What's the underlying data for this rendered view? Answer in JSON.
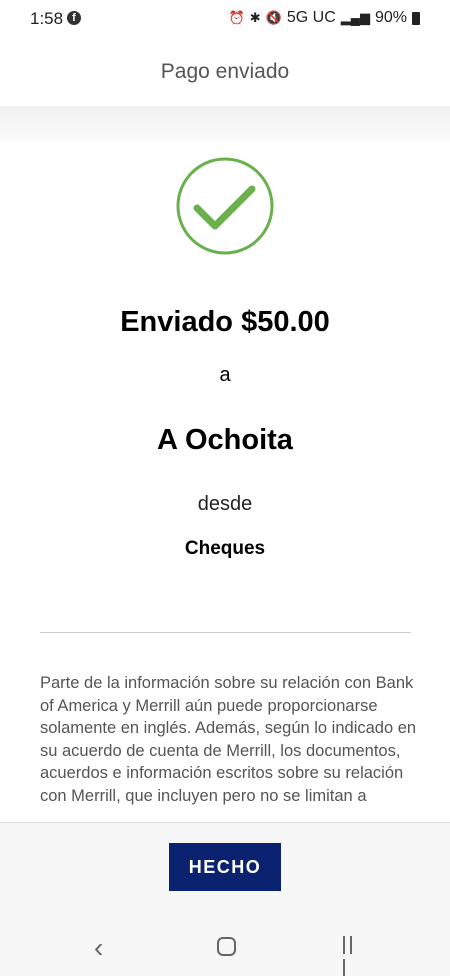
{
  "status_bar": {
    "time": "1:58",
    "network": "5G UC",
    "battery": "90%"
  },
  "header": {
    "title": "Pago enviado"
  },
  "confirmation": {
    "amount_text": "Enviado $50.00",
    "to_word": "a",
    "recipient": "A Ochoita",
    "from_word": "desde",
    "account": "Cheques"
  },
  "disclaimer": {
    "text": "Parte de la información sobre su relación con Bank of America y Merrill aún puede proporcionarse solamente en inglés. Además, según lo indicado en su acuerdo de cuenta de Merrill, los documentos, acuerdos e información escritos sobre su relación con Merrill, que incluyen pero no se limitan a"
  },
  "actions": {
    "done_label": "HECHO"
  },
  "colors": {
    "check_green": "#6ab04c",
    "button_navy": "#0a2270"
  }
}
